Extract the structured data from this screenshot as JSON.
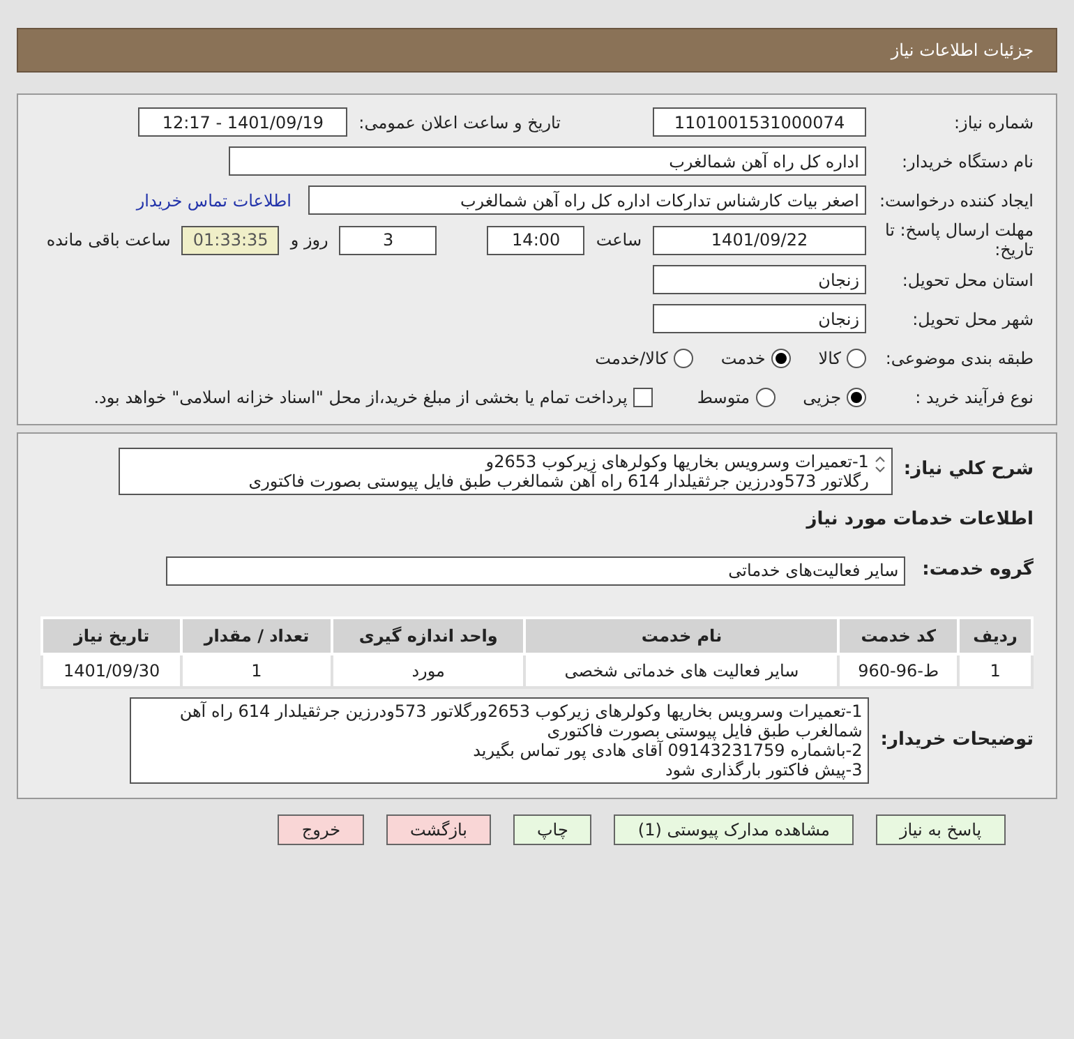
{
  "header": {
    "title": "جزئیات اطلاعات نیاز"
  },
  "info": {
    "need_number": {
      "label": "شماره نیاز:",
      "value": "1101001531000074"
    },
    "announce": {
      "label": "تاریخ و ساعت اعلان عمومی:",
      "value": "1401/09/19 - 12:17"
    },
    "buyer": {
      "label": "نام دستگاه خریدار:",
      "value": "اداره کل راه آهن شمالغرب"
    },
    "creator": {
      "label": "ایجاد کننده درخواست:",
      "value": "اصغر بیات کارشناس تدارکات اداره کل راه آهن شمالغرب",
      "link": "اطلاعات تماس خریدار"
    },
    "deadline": {
      "label": "مهلت ارسال پاسخ: تا تاریخ:",
      "date": "1401/09/22",
      "time_label": "ساعت",
      "time": "14:00",
      "days": "3",
      "days_label": "روز و",
      "remaining": "01:33:35",
      "remaining_label": "ساعت باقی مانده"
    },
    "province": {
      "label": "استان محل تحویل:",
      "value": "زنجان"
    },
    "city": {
      "label": "شهر محل تحویل:",
      "value": "زنجان"
    },
    "category": {
      "label": "طبقه بندی موضوعی:",
      "options": [
        {
          "label": "کالا",
          "selected": false
        },
        {
          "label": "خدمت",
          "selected": true
        },
        {
          "label": "کالا/خدمت",
          "selected": false
        }
      ]
    },
    "process": {
      "label": "نوع فرآیند خرید :",
      "options": [
        {
          "label": "جزیی",
          "selected": true
        },
        {
          "label": "متوسط",
          "selected": false
        }
      ],
      "treasury": {
        "checked": false,
        "label": "پرداخت تمام یا بخشی از مبلغ خرید،از محل \"اسناد خزانه اسلامی\" خواهد بود."
      }
    }
  },
  "details": {
    "description": {
      "label": "شرح کلي نياز:",
      "lines": [
        "1-تعمیرات وسرویس بخاریها وکولرهای زیرکوب 2653و",
        "رگلاتور 573ودرزین جرثقیلدار 614 راه آهن شمالغرب طبق فایل پیوستی بصورت فاکتوری"
      ]
    },
    "section_title": "اطلاعات خدمات مورد نیاز",
    "service_group": {
      "label": "گروه خدمت:",
      "value": "سایر فعالیت‌های خدماتی"
    },
    "table": {
      "columns": [
        "ردیف",
        "کد خدمت",
        "نام خدمت",
        "واحد اندازه گیری",
        "تعداد / مقدار",
        "تاریخ نیاز"
      ],
      "rows": [
        [
          "1",
          "ط-96-960",
          "سایر فعالیت های خدماتی شخصی",
          "مورد",
          "1",
          "1401/09/30"
        ]
      ]
    },
    "notes": {
      "label": "توضیحات خریدار:",
      "lines": [
        "1-تعمیرات وسرویس بخاریها وکولرهای زیرکوب 2653ورگلاتور 573ودرزین جرثقیلدار 614 راه آهن شمالغرب طبق فایل پیوستی بصورت فاکتوری",
        "2-باشماره 09143231759 آقای هادی پور تماس بگیرید",
        "3-پیش فاکتور بارگذاری شود"
      ]
    }
  },
  "buttons": [
    {
      "label": "پاسخ به نیاز",
      "kind": "normal"
    },
    {
      "label": "مشاهده مدارک پیوستی (1)",
      "kind": "normal"
    },
    {
      "label": "چاپ",
      "kind": "normal"
    },
    {
      "label": "بازگشت",
      "kind": "danger"
    },
    {
      "label": "خروج",
      "kind": "danger"
    }
  ]
}
